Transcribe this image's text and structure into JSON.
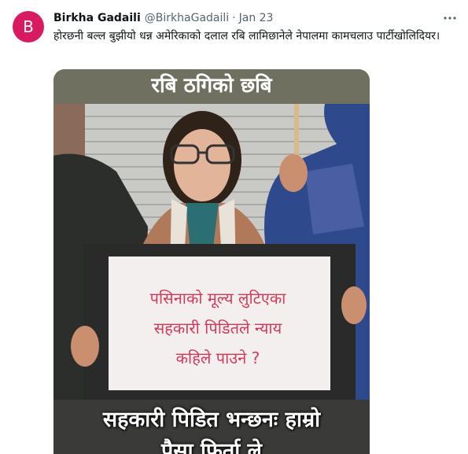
{
  "tweet": {
    "avatar_initial": "B",
    "avatar_color": "#d81b60",
    "display_name": "Birkha Gadaili",
    "handle": "@BirkhaGadaili",
    "separator": "·",
    "date": "Jan 23",
    "more_icon": "more-horizontal-icon",
    "text": "होरछनी बल्ल बुझीयो धन्न अमेरिकाको दलाल रबि लामिछानेले नेपालमा कामचलाउ पार्टीखोलिदियर।"
  },
  "media": {
    "banner": "रबि ठगिको छबि",
    "sign_lines": [
      "पसिनाको मूल्य लुटिएका",
      "सहकारी पिडितले न्याय",
      "कहिले पाउने ?"
    ],
    "caption_lines": [
      "सहकारी पिडित भन्छनः हाम्रो",
      "पैसा फिर्ता ले"
    ]
  }
}
